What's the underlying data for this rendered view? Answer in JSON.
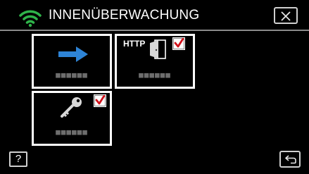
{
  "header": {
    "title": "INNENÜBERWACHUNG",
    "icon": "wifi-icon",
    "close_icon": "close-icon"
  },
  "tiles": [
    {
      "label": "■■■■■■",
      "icon": "arrow-right-icon",
      "checked": false
    },
    {
      "label": "■■■■■■",
      "icon_text": "HTTP",
      "icon": "http-door-icon",
      "checked": true
    },
    {
      "label": "■■■■■■",
      "icon": "key-icon",
      "checked": true
    }
  ],
  "footer": {
    "help_label": "?",
    "back_icon": "return-icon"
  },
  "colors": {
    "accent_green": "#2fb44a",
    "arrow_blue": "#2e84d6",
    "check_red": "#d0121b"
  }
}
